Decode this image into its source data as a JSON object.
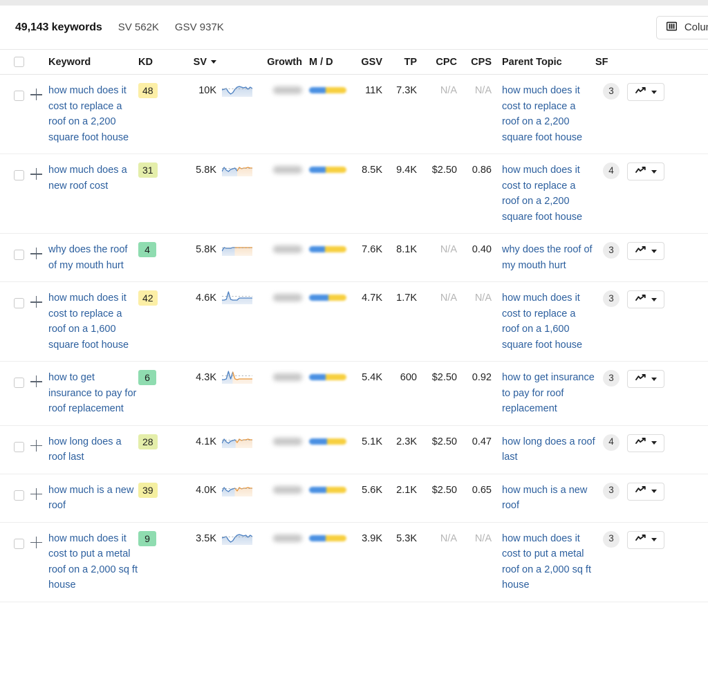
{
  "summary": {
    "keywords_count": "49,143 keywords",
    "sv_total": "SV 562K",
    "gsv_total": "GSV 937K",
    "columns_button": "Columns",
    "columns_icon": "columns-icon"
  },
  "table": {
    "headers": {
      "keyword": "Keyword",
      "kd": "KD",
      "sv": "SV",
      "growth": "Growth",
      "md": "M / D",
      "gsv": "GSV",
      "tp": "TP",
      "cpc": "CPC",
      "cps": "CPS",
      "parent_topic": "Parent Topic",
      "sf": "SF"
    },
    "sort_column": "SV",
    "sort_direction": "desc",
    "rows": [
      {
        "keyword": "how much does it cost to replace a roof on a 2,200 square foot house",
        "kd": "48",
        "kd_color": "#fcefa6",
        "sv": "10K",
        "growth": "",
        "md_blue_pct": 45,
        "md_yellow_pct": 55,
        "gsv": "11K",
        "tp": "7.3K",
        "cpc": "N/A",
        "cps": "N/A",
        "parent_topic": "how much does it cost to replace a roof on a 2,200 square foot house",
        "sf": "3",
        "spark": "dip-rise-blue",
        "spark_split": 1.0
      },
      {
        "keyword": "how much does a new roof cost",
        "kd": "31",
        "kd_color": "#e4eeaa",
        "sv": "5.8K",
        "growth": "",
        "md_blue_pct": 45,
        "md_yellow_pct": 55,
        "gsv": "8.5K",
        "tp": "9.4K",
        "cpc": "$2.50",
        "cps": "0.86",
        "parent_topic": "how much does it cost to replace a roof on a 2,200 square foot house",
        "sf": "4",
        "spark": "wave-split",
        "spark_split": 0.5
      },
      {
        "keyword": "why does the roof of my mouth hurt",
        "kd": "4",
        "kd_color": "#8fdcb0",
        "sv": "5.8K",
        "growth": "",
        "md_blue_pct": 42,
        "md_yellow_pct": 58,
        "gsv": "7.6K",
        "tp": "8.1K",
        "cpc": "N/A",
        "cps": "0.40",
        "parent_topic": "why does the roof of my mouth hurt",
        "sf": "3",
        "spark": "flat-split",
        "spark_split": 0.42
      },
      {
        "keyword": "how much does it cost to replace a roof on a 1,600 square foot house",
        "kd": "42",
        "kd_color": "#fcefa6",
        "sv": "4.6K",
        "growth": "",
        "md_blue_pct": 52,
        "md_yellow_pct": 48,
        "gsv": "4.7K",
        "tp": "1.7K",
        "cpc": "N/A",
        "cps": "N/A",
        "parent_topic": "how much does it cost to replace a roof on a 1,600 square foot house",
        "sf": "3",
        "spark": "spike-blue",
        "spark_split": 1.0
      },
      {
        "keyword": "how to get insurance to pay for roof replacement",
        "kd": "6",
        "kd_color": "#8fdcb0",
        "sv": "4.3K",
        "growth": "",
        "md_blue_pct": 45,
        "md_yellow_pct": 55,
        "gsv": "5.4K",
        "tp": "600",
        "cpc": "$2.50",
        "cps": "0.92",
        "parent_topic": "how to get insurance to pay for roof replacement",
        "sf": "3",
        "spark": "double-spike",
        "spark_split": 0.35
      },
      {
        "keyword": "how long does a roof last",
        "kd": "28",
        "kd_color": "#e4eeaa",
        "sv": "4.1K",
        "growth": "",
        "md_blue_pct": 48,
        "md_yellow_pct": 52,
        "gsv": "5.1K",
        "tp": "2.3K",
        "cpc": "$2.50",
        "cps": "0.47",
        "parent_topic": "how long does a roof last",
        "sf": "4",
        "spark": "wave-split",
        "spark_split": 0.45
      },
      {
        "keyword": "how much is a new roof",
        "kd": "39",
        "kd_color": "#f4efa0",
        "sv": "4.0K",
        "growth": "",
        "md_blue_pct": 47,
        "md_yellow_pct": 53,
        "gsv": "5.6K",
        "tp": "2.1K",
        "cpc": "$2.50",
        "cps": "0.65",
        "parent_topic": "how much is a new roof",
        "sf": "3",
        "spark": "wave-split",
        "spark_split": 0.42
      },
      {
        "keyword": "how much does it cost to put a metal roof on a 2,000 sq ft house",
        "kd": "9",
        "kd_color": "#8fdcb0",
        "sv": "3.5K",
        "growth": "",
        "md_blue_pct": 45,
        "md_yellow_pct": 55,
        "gsv": "3.9K",
        "tp": "5.3K",
        "cpc": "N/A",
        "cps": "N/A",
        "parent_topic": "how much does it cost to put a metal roof on a 2,000 sq ft house",
        "sf": "3",
        "spark": "dip-rise-blue",
        "spark_split": 1.0
      }
    ]
  },
  "colors": {
    "link": "#2c5f9e",
    "spark_blue": "#4a7fc1",
    "spark_orange": "#e8963c",
    "md_blue": "#4a90e2",
    "md_yellow": "#f7cf3f"
  }
}
